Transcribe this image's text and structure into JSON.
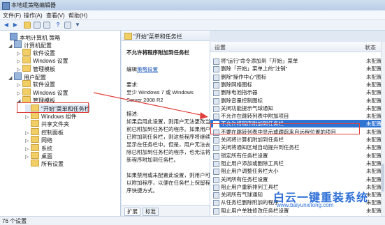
{
  "window": {
    "title": "本地组策略编辑器"
  },
  "menu": [
    "文件(F)",
    "操作(A)",
    "查看(V)",
    "帮助(H)"
  ],
  "tree": {
    "items": [
      {
        "label": "本地计算机 策略",
        "type": "policy",
        "expander": ""
      },
      {
        "label": "计算机配置",
        "type": "computer",
        "expander": "◢"
      },
      {
        "label": "软件设置",
        "type": "folder",
        "expander": "▷"
      },
      {
        "label": "Windows 设置",
        "type": "folder",
        "expander": "▷"
      },
      {
        "label": "管理模板",
        "type": "folder",
        "expander": "▷"
      },
      {
        "label": "用户配置",
        "type": "user",
        "expander": "◢"
      },
      {
        "label": "软件设置",
        "type": "folder",
        "expander": "▷"
      },
      {
        "label": "Windows 设置",
        "type": "folder",
        "expander": "▷"
      },
      {
        "label": "管理模板",
        "type": "folder",
        "expander": "◢"
      },
      {
        "label": "\"开始\"菜单和任务栏",
        "type": "folder",
        "expander": "",
        "selected": true
      },
      {
        "label": "Windows 组件",
        "type": "folder",
        "expander": "▷"
      },
      {
        "label": "共享文件夹",
        "type": "folder",
        "expander": ""
      },
      {
        "label": "控制面板",
        "type": "folder",
        "expander": "▷"
      },
      {
        "label": "网络",
        "type": "folder",
        "expander": "▷"
      },
      {
        "label": "系统",
        "type": "folder",
        "expander": "▷"
      },
      {
        "label": "桌面",
        "type": "folder",
        "expander": "▷"
      },
      {
        "label": "所有设置",
        "type": "folder",
        "expander": ""
      }
    ]
  },
  "description": {
    "header": "\"开始\"菜单和任务栏",
    "policy_title": "不允许将程序附加到任务栏",
    "edit_prefix": "编辑",
    "edit_link": "策略设置",
    "requirements_label": "要求:",
    "requirements_lines": [
      "至少 Windows 7 或 Windows",
      "Server 2008 R2"
    ],
    "desc_label": "描述:",
    "desc_lines": [
      "如果启用此设置，则用户无法更改当",
      "前已附加到任务栏的程序。如果用户",
      "已附加到任务栏，则这些程序将继续",
      "显示在任务栏中。但是，用户无法去",
      "除已附加到任务栏的程序，也无法将",
      "新程序附加到任务栏。",
      "",
      "如果禁用或未配置此设置，则用户可",
      "以附加程序，以便在任务栏上保留程",
      "序快捷方式。"
    ],
    "tabs": [
      "扩展",
      "标准"
    ]
  },
  "settings": {
    "col_setting": "设置",
    "col_state": "状态",
    "rows": [
      {
        "name": "将\"运行\"命令添加到「开始」菜单",
        "state": "未配置"
      },
      {
        "name": "删除「开始」菜单上的\"注销\"",
        "state": "未配置"
      },
      {
        "name": "删除\"操作中心\"图标",
        "state": "未配置"
      },
      {
        "name": "删除网络图标",
        "state": "未配置"
      },
      {
        "name": "删除电池指示器",
        "state": "未配置"
      },
      {
        "name": "删除音量控制图标",
        "state": "未配置"
      },
      {
        "name": "关闭功能提示气球通知",
        "state": "未配置"
      },
      {
        "name": "不允许在跳转列表中附加项目",
        "state": "未配置"
      },
      {
        "name": "不允许将程序附加到任务栏",
        "state": "未配置",
        "selected": true
      },
      {
        "name": "不要在跳转列表中显示或跟踪来自远程位置的项目",
        "state": "未配置"
      },
      {
        "name": "关闭将计算机附加到任务栏",
        "state": "未配置"
      },
      {
        "name": "关闭将通知区域自动提升到任务栏",
        "state": "未配置"
      },
      {
        "name": "锁定所有任务栏设置",
        "state": "未配置"
      },
      {
        "name": "阻止用户添加或删除工具栏",
        "state": "未配置"
      },
      {
        "name": "阻止用户调整任务栏大小",
        "state": "未配置"
      },
      {
        "name": "关闭所有任务栏设置",
        "state": "未配置"
      },
      {
        "name": "阻止用户重新排列工具栏",
        "state": "未配置"
      },
      {
        "name": "关闭所有气球通知",
        "state": "未配置"
      },
      {
        "name": "从任务栏删除附加的程序",
        "state": "未配置"
      },
      {
        "name": "阻止用户单独修改任务栏设置",
        "state": "未配置"
      },
      {
        "name": "关闭任务栏上的所有快捷方式",
        "state": "未配置"
      }
    ]
  },
  "status": {
    "text": "76 个设置"
  },
  "watermark": {
    "title": "白云一键重装系统",
    "url": "www.baiyunxitong.com"
  },
  "colors": {
    "selection": "#2f73d3",
    "annotation": "#e0403c",
    "link": "#1f5bb8"
  }
}
